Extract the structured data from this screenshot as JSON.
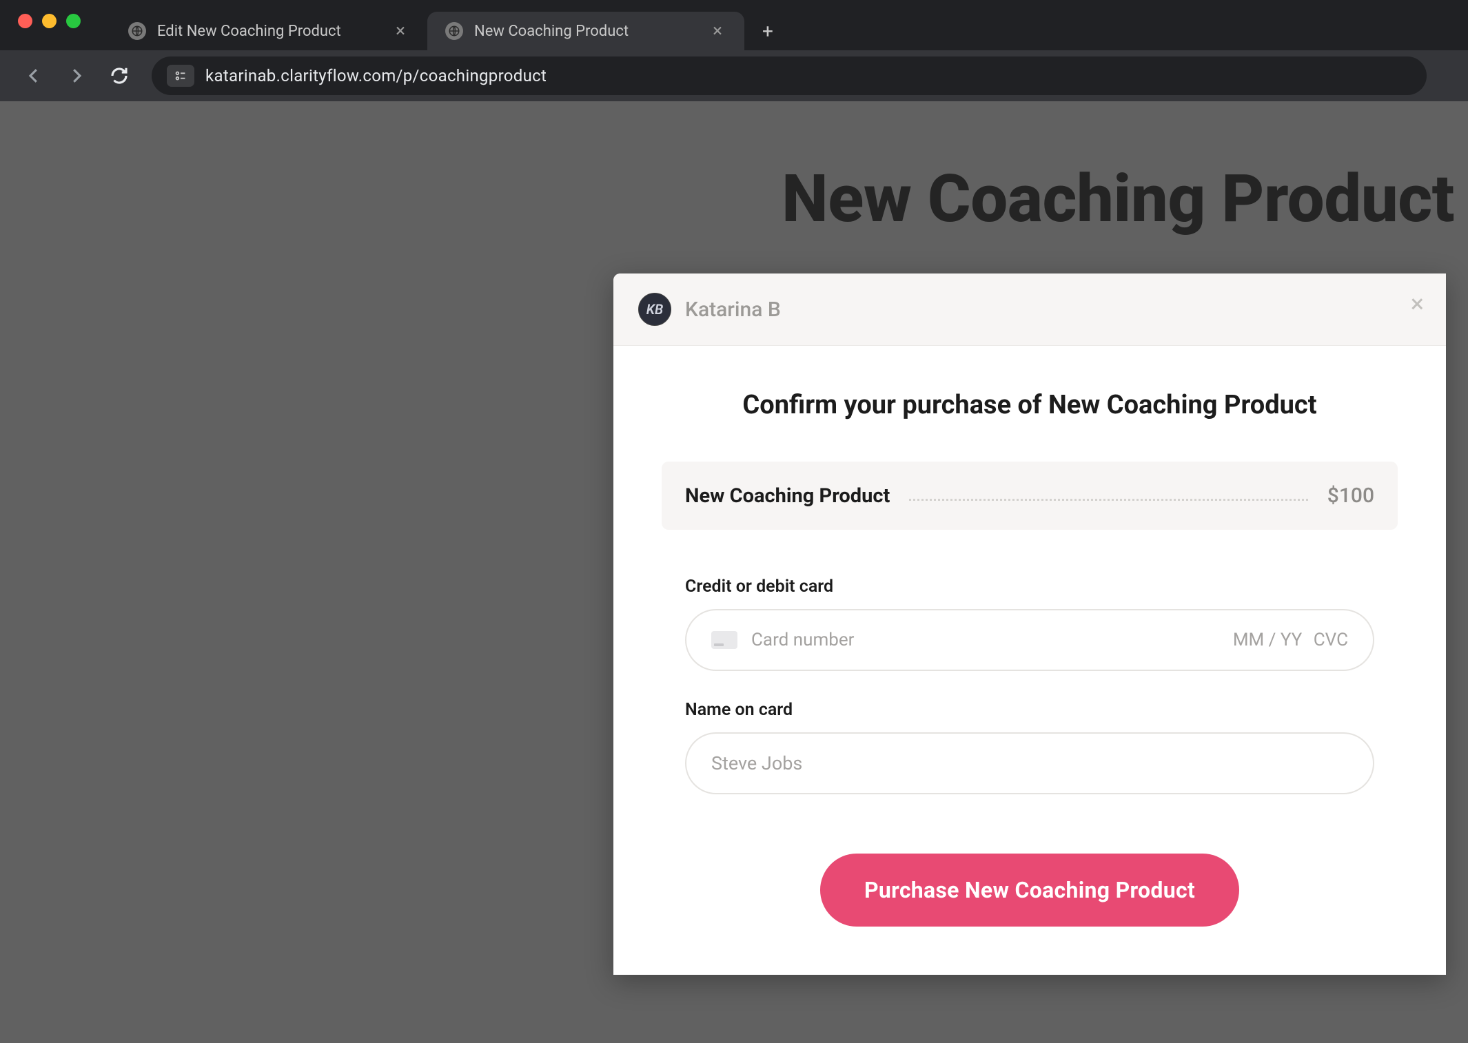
{
  "browser": {
    "tabs": [
      {
        "title": "Edit New Coaching Product",
        "active": false
      },
      {
        "title": "New Coaching Product",
        "active": true
      }
    ],
    "url": "katarinab.clarityflow.com/p/coachingproduct"
  },
  "page": {
    "title": "New Coaching Product"
  },
  "modal": {
    "seller_name": "Katarina B",
    "avatar_initials": "KB",
    "heading": "Confirm your purchase of New Coaching Product",
    "line_item": {
      "name": "New Coaching Product",
      "price": "$100"
    },
    "fields": {
      "card_label": "Credit or debit card",
      "card_number_placeholder": "Card number",
      "card_expiry_placeholder": "MM / YY",
      "card_cvc_placeholder": "CVC",
      "name_label": "Name on card",
      "name_placeholder": "Steve Jobs"
    },
    "purchase_button": "Purchase New Coaching Product"
  }
}
